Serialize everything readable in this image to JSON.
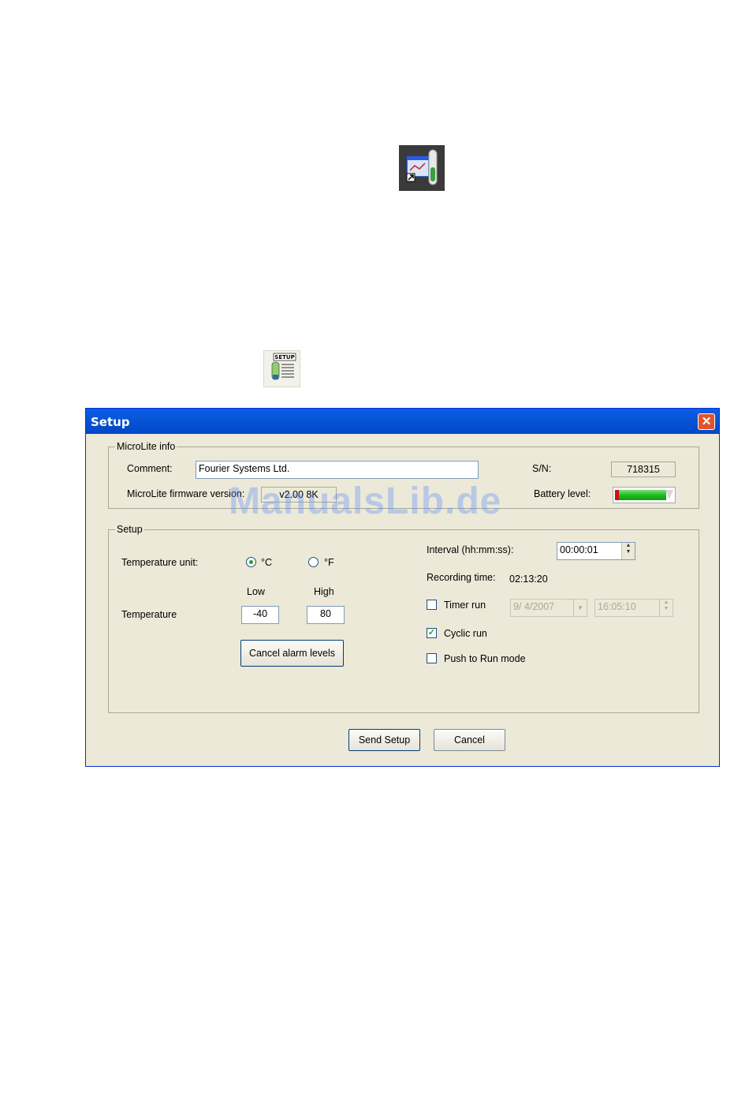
{
  "dialog": {
    "title": "Setup",
    "close_glyph": "✕"
  },
  "info": {
    "legend": "MicroLite info",
    "comment_label": "Comment:",
    "comment_value": "Fourier Systems Ltd.",
    "sn_label": "S/N:",
    "sn_value": "718315",
    "firmware_label": "MicroLite firmware version:",
    "firmware_value": "v2.00  8K",
    "battery_label": "Battery level:"
  },
  "setup": {
    "legend": "Setup",
    "temp_unit_label": "Temperature unit:",
    "unit_c": "°C",
    "unit_f": "°F",
    "low_label": "Low",
    "high_label": "High",
    "temperature_label": "Temperature",
    "low_value": "-40",
    "high_value": "80",
    "cancel_alarm_label": "Cancel alarm levels",
    "interval_label": "Interval  (hh:mm:ss):",
    "interval_value": "00:00:01",
    "recording_label": "Recording time:",
    "recording_value": "02:13:20",
    "timer_run_label": "Timer run",
    "timer_date": "9/  4/2007",
    "timer_time": "16:05:10",
    "cyclic_run_label": "Cyclic run",
    "push_to_run_label": "Push to Run mode"
  },
  "buttons": {
    "send_setup": "Send Setup",
    "cancel": "Cancel"
  },
  "watermark": "ManualsLib.de",
  "colors": {
    "title_bar": "#0854d6",
    "dialog_bg": "#ece9d8",
    "battery_green": "#1fbf1f",
    "battery_red": "#d01010"
  }
}
